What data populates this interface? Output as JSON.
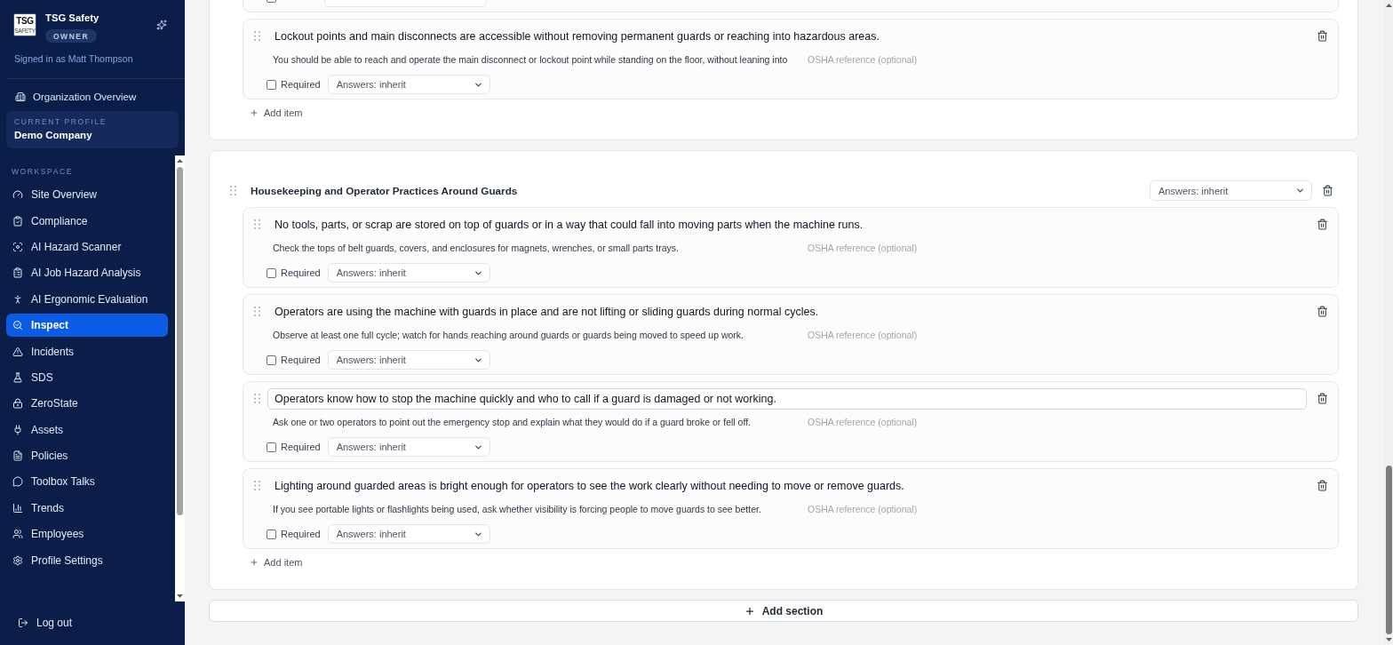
{
  "sidebar": {
    "logo": {
      "wordmark": "TSG",
      "tagline": "SAFETY"
    },
    "org_name": "TSG Safety",
    "role_badge": "OWNER",
    "signed_in": "Signed in as Matt Thompson",
    "org_overview": "Organization Overview",
    "current_profile": {
      "label": "CURRENT PROFILE",
      "name": "Demo Company"
    },
    "workspace_label": "WORKSPACE",
    "items": [
      {
        "label": "Site Overview",
        "selected": false
      },
      {
        "label": "Compliance",
        "selected": false
      },
      {
        "label": "AI Hazard Scanner",
        "selected": false
      },
      {
        "label": "AI Job Hazard Analysis",
        "selected": false
      },
      {
        "label": "AI Ergonomic Evaluation",
        "selected": false
      },
      {
        "label": "Inspect",
        "selected": true
      },
      {
        "label": "Incidents",
        "selected": false
      },
      {
        "label": "SDS",
        "selected": false
      },
      {
        "label": "ZeroState",
        "selected": false
      },
      {
        "label": "Assets",
        "selected": false
      },
      {
        "label": "Policies",
        "selected": false
      },
      {
        "label": "Toolbox Talks",
        "selected": false
      },
      {
        "label": "Trends",
        "selected": false
      },
      {
        "label": "Employees",
        "selected": false
      },
      {
        "label": "Profile Settings",
        "selected": false
      }
    ],
    "logout": "Log out"
  },
  "sections": [
    {
      "items": [
        {
          "kind": "cut_off",
          "required": false
        },
        {
          "kind": "full",
          "title": "Lockout points and main disconnects are accessible without removing permanent guards or reaching into hazardous areas.",
          "description": "You should be able to reach and operate the main disconnect or lockout point while standing on the floor, without leaning into",
          "osha_placeholder": "OSHA reference (optional)",
          "required": false,
          "required_label": "Required",
          "answers": "Answers: inherit",
          "focused": false
        }
      ],
      "add_item": "Add item"
    },
    {
      "title": "Housekeeping and Operator Practices Around Guards",
      "answers": "Answers: inherit",
      "items": [
        {
          "kind": "full",
          "title": "No tools, parts, or scrap are stored on top of guards or in a way that could fall into moving parts when the machine runs.",
          "description": "Check the tops of belt guards, covers, and enclosures for magnets, wrenches, or small parts trays.",
          "osha_placeholder": "OSHA reference (optional)",
          "required": false,
          "required_label": "Required",
          "answers": "Answers: inherit",
          "focused": false
        },
        {
          "kind": "full",
          "title": "Operators are using the machine with guards in place and are not lifting or sliding guards during normal cycles.",
          "description": "Observe at least one full cycle; watch for hands reaching around guards or guards being moved to speed up work.",
          "osha_placeholder": "OSHA reference (optional)",
          "required": false,
          "required_label": "Required",
          "answers": "Answers: inherit",
          "focused": false
        },
        {
          "kind": "full",
          "title": "Operators know how to stop the machine quickly and who to call if a guard is damaged or not working.",
          "description": "Ask one or two operators to point out the emergency stop and explain what they would do if a guard broke or fell off.",
          "osha_placeholder": "OSHA reference (optional)",
          "required": false,
          "required_label": "Required",
          "answers": "Answers: inherit",
          "focused": true
        },
        {
          "kind": "full",
          "title": "Lighting around guarded areas is bright enough for operators to see the work clearly without needing to move or remove guards.",
          "description": "If you see portable lights or flashlights being used, ask whether visibility is forcing people to move guards to see better.",
          "osha_placeholder": "OSHA reference (optional)",
          "required": false,
          "required_label": "Required",
          "answers": "Answers: inherit",
          "focused": false
        }
      ],
      "add_item": "Add item"
    }
  ],
  "add_section": "Add section"
}
